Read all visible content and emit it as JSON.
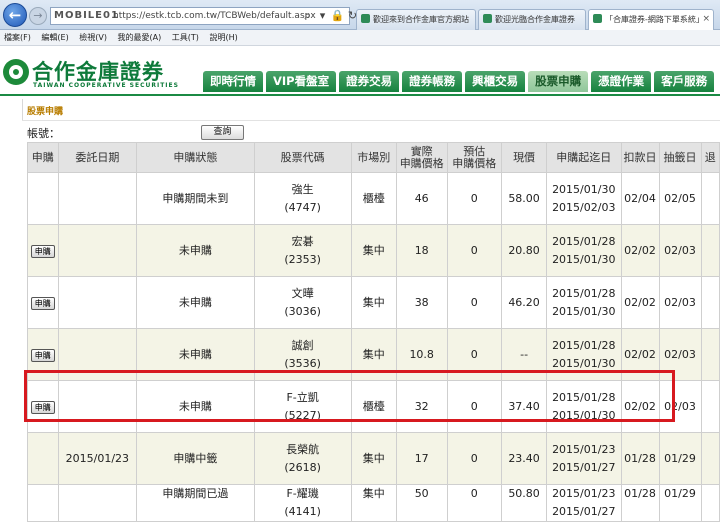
{
  "browser": {
    "address": {
      "logo": "MOBILE01",
      "url": "https://estk.tcb.com.tw/TCBWeb/default.aspx"
    },
    "tabs": [
      {
        "label": "歡迎來到合作金庫官方網站"
      },
      {
        "label": "歡迎光臨合作金庫證券"
      },
      {
        "label": "「合庫證券-網路下單系統」"
      }
    ],
    "menu": [
      "檔案(F)",
      "編輯(E)",
      "檢視(V)",
      "我的最愛(A)",
      "工具(T)",
      "說明(H)"
    ]
  },
  "site": {
    "logo_name": "合作金庫證券",
    "logo_en": "TAIWAN COOPERATIVE SECURITIES",
    "nav": [
      {
        "label": "即時行情",
        "active": false
      },
      {
        "label": "VIP看盤室",
        "active": false
      },
      {
        "label": "證券交易",
        "active": false
      },
      {
        "label": "證券帳務",
        "active": false
      },
      {
        "label": "興櫃交易",
        "active": false
      },
      {
        "label": "股票申購",
        "active": true
      },
      {
        "label": "憑證作業",
        "active": false
      },
      {
        "label": "客戶服務",
        "active": false
      }
    ],
    "accent_color": "#16823f"
  },
  "page": {
    "title": "股票申購",
    "account_label": "帳號：",
    "query_button": "查詢"
  },
  "table": {
    "headers": [
      "申購",
      "委託日期",
      "申購狀態",
      "股票代碼",
      "市場別",
      "實際\n申購價格",
      "預估\n申購價格",
      "現價",
      "申購起迄日",
      "扣款日",
      "抽籤日",
      "退"
    ],
    "apply_label": "申購",
    "rows": [
      {
        "apply": false,
        "date": "",
        "status": "申購期間未到",
        "name": "強生",
        "code": "(4747)",
        "market": "櫃檯",
        "actual": "46",
        "est": "0",
        "price": "58.00",
        "start": "2015/01/30",
        "end": "2015/02/03",
        "debit": "02/04",
        "draw": "02/05"
      },
      {
        "apply": true,
        "date": "",
        "status": "未申購",
        "name": "宏碁",
        "code": "(2353)",
        "market": "集中",
        "actual": "18",
        "est": "0",
        "price": "20.80",
        "start": "2015/01/28",
        "end": "2015/01/30",
        "debit": "02/02",
        "draw": "02/03"
      },
      {
        "apply": true,
        "date": "",
        "status": "未申購",
        "name": "文曄",
        "code": "(3036)",
        "market": "集中",
        "actual": "38",
        "est": "0",
        "price": "46.20",
        "start": "2015/01/28",
        "end": "2015/01/30",
        "debit": "02/02",
        "draw": "02/03"
      },
      {
        "apply": true,
        "date": "",
        "status": "未申購",
        "name": "誠創",
        "code": "(3536)",
        "market": "集中",
        "actual": "10.8",
        "est": "0",
        "price": "--",
        "start": "2015/01/28",
        "end": "2015/01/30",
        "debit": "02/02",
        "draw": "02/03"
      },
      {
        "apply": true,
        "date": "",
        "status": "未申購",
        "name": "F-立凱",
        "code": "(5227)",
        "market": "櫃檯",
        "actual": "32",
        "est": "0",
        "price": "37.40",
        "start": "2015/01/28",
        "end": "2015/01/30",
        "debit": "02/02",
        "draw": "02/03"
      },
      {
        "apply": false,
        "date": "2015/01/23",
        "status": "申購中籤",
        "name": "長榮航",
        "code": "(2618)",
        "market": "集中",
        "actual": "17",
        "est": "0",
        "price": "23.40",
        "start": "2015/01/23",
        "end": "2015/01/27",
        "debit": "01/28",
        "draw": "01/29"
      },
      {
        "apply": false,
        "date": "",
        "status": "申購期間已過",
        "name": "F-耀璣",
        "code": "(4141)",
        "market": "集中",
        "actual": "50",
        "est": "0",
        "price": "50.80",
        "start": "2015/01/23",
        "end": "2015/01/27",
        "debit": "01/28",
        "draw": "01/29"
      }
    ]
  }
}
